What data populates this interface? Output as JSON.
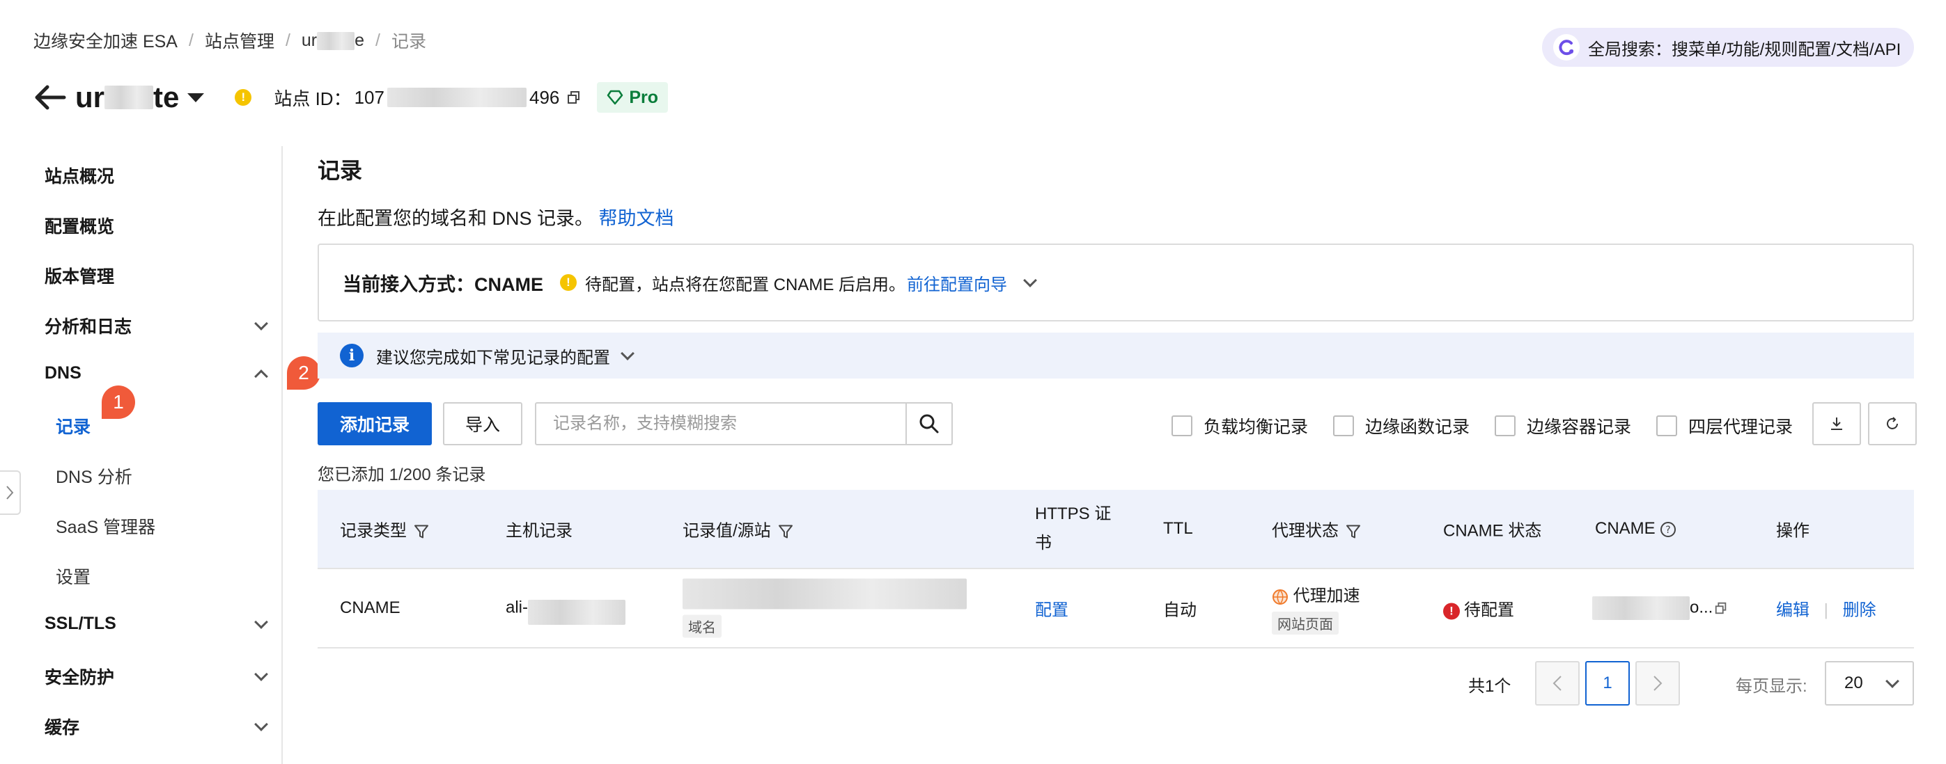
{
  "breadcrumb": {
    "items": [
      "边缘安全加速 ESA",
      "站点管理",
      "ur",
      "e",
      "记录"
    ],
    "separator": "/"
  },
  "global_search": {
    "label": "全局搜索：搜菜单/功能/规则配置/文档/API"
  },
  "site": {
    "name_start": "ur",
    "name_end": "te",
    "id_label": "站点 ID：",
    "id_start": "107",
    "id_end": "496",
    "plan": "Pro"
  },
  "sidebar": {
    "items": [
      {
        "label": "站点概况"
      },
      {
        "label": "配置概览"
      },
      {
        "label": "版本管理"
      },
      {
        "label": "分析和日志"
      },
      {
        "label": "DNS"
      },
      {
        "label": "记录"
      },
      {
        "label": "DNS 分析"
      },
      {
        "label": "SaaS 管理器"
      },
      {
        "label": "设置"
      },
      {
        "label": "SSL/TLS"
      },
      {
        "label": "安全防护"
      },
      {
        "label": "缓存"
      }
    ],
    "badge_1": "1",
    "badge_2": "2"
  },
  "main": {
    "title": "记录",
    "desc": "在此配置您的域名和 DNS 记录。",
    "help_link": "帮助文档",
    "access": {
      "label": "当前接入方式：CNAME",
      "status": "待配置，站点将在您配置 CNAME 后启用。",
      "link": "前往配置向导"
    },
    "tip": "建议您完成如下常见记录的配置",
    "toolbar": {
      "add": "添加记录",
      "import": "导入",
      "search_placeholder": "记录名称，支持模糊搜索",
      "filters": [
        "负载均衡记录",
        "边缘函数记录",
        "边缘容器记录",
        "四层代理记录"
      ]
    },
    "count": "您已添加 1/200 条记录",
    "table": {
      "headers": [
        "记录类型",
        "主机记录",
        "记录值/源站",
        "HTTPS 证",
        "书",
        "TTL",
        "代理状态",
        "CNAME 状态",
        "CNAME",
        "操作"
      ],
      "row": {
        "type": "CNAME",
        "host": "ali-",
        "value_tag": "域名",
        "https": "配置",
        "ttl": "自动",
        "proxy": "代理加速",
        "proxy_tag": "网站页面",
        "cname_status": "待配置",
        "cname_end": "o...",
        "edit": "编辑",
        "delete": "删除"
      }
    },
    "pagination": {
      "total": "共1个",
      "current": "1",
      "per_page_label": "每页显示:",
      "per_page": "20"
    }
  },
  "colors": {
    "primary": "#1163d2",
    "warning": "#f5c400",
    "danger": "#d9262a",
    "badge": "#f05a3a"
  }
}
